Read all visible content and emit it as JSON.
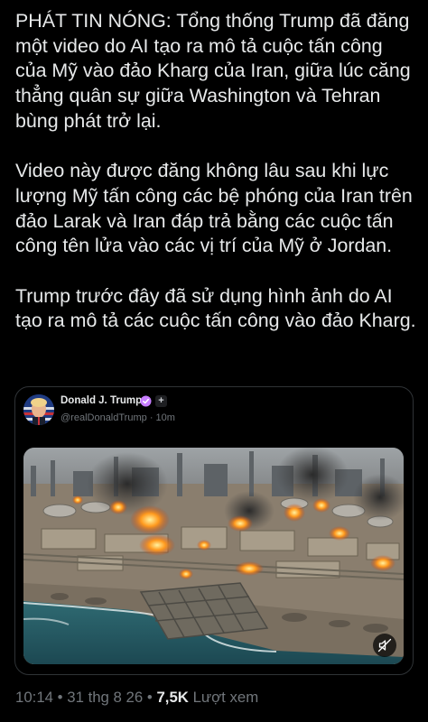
{
  "post": {
    "paragraphs": [
      "PHÁT TIN NÓNG: Tổng thống Trump đã đăng một video do AI tạo ra mô tả cuộc tấn công của Mỹ vào đảo Kharg của Iran, giữa lúc căng thẳng quân sự giữa Washington và Tehran bùng phát trở lại.",
      "Video này được đăng không lâu sau khi lực lượng Mỹ tấn công các bệ phóng của Iran trên đảo Larak và Iran đáp trả bằng các cuộc tấn công tên lửa vào các vị trí của Mỹ ở Jordan.",
      "Trump trước đây đã sử dụng hình ảnh do AI tạo ra mô tả các cuộc tấn công vào đảo Kharg."
    ]
  },
  "quote": {
    "author_name": "Donald J. Trump",
    "handle": "@realDonaldTrump",
    "time_ago": "10m",
    "separator": "·",
    "verified_icon": "verified-badge-icon",
    "affiliation_icon": "affiliation-plus-icon",
    "media": {
      "type": "video",
      "mute_icon": "muted-speaker-icon"
    }
  },
  "meta": {
    "time": "10:14",
    "date": "31 thg 8 26",
    "bullet": "•",
    "views_count": "7,5K",
    "views_label": "Lượt xem"
  },
  "colors": {
    "background": "#000000",
    "text_primary": "#e7e9ea",
    "text_secondary": "#71767b",
    "card_border": "#2f3336",
    "verified_badge": "#c77dff"
  }
}
